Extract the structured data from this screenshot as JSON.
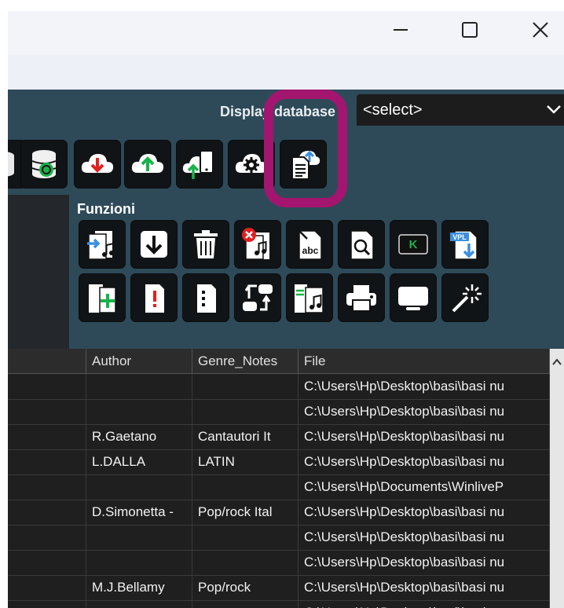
{
  "window": {
    "minimize_glyph": "—",
    "maximize_glyph": "☐",
    "close_glyph": "✕"
  },
  "toolbar": {
    "display_label": "Display database",
    "db_select_value": "<select>",
    "icons": [
      "database-partial-icon",
      "database-sync-icon",
      "cloud-download-icon",
      "cloud-upload-icon",
      "cloud-upload-mobile-icon",
      "cloud-settings-icon",
      "cloud-upload-document-icon"
    ]
  },
  "funzioni": {
    "label": "Funzioni",
    "row1": [
      "import-music-icon",
      "download-arrow-icon",
      "trash-icon",
      "delete-music-icon",
      "rename-abc-icon",
      "search-document-icon",
      "karaoke-k-icon",
      "vpl-download-icon"
    ],
    "row2": [
      "add-document-icon",
      "alert-document-icon",
      "list-document-icon",
      "swap-icon",
      "music-list-icon",
      "print-icon",
      "monitor-icon",
      "magic-wand-icon"
    ]
  },
  "table": {
    "columns": [
      "Author",
      "Genre_Notes",
      "File"
    ],
    "rows": [
      {
        "author": "",
        "genre": "",
        "file": "C:\\Users\\Hp\\Desktop\\basi\\basi nu"
      },
      {
        "author": "",
        "genre": "",
        "file": "C:\\Users\\Hp\\Desktop\\basi\\basi nu"
      },
      {
        "author": "R.Gaetano",
        "genre": "Cantautori It",
        "file": "C:\\Users\\Hp\\Desktop\\basi\\basi nu"
      },
      {
        "author": "L.DALLA",
        "genre": "LATIN",
        "file": "C:\\Users\\Hp\\Desktop\\basi\\basi nu"
      },
      {
        "author": "",
        "genre": "",
        "file": "C:\\Users\\Hp\\Documents\\WinliveP"
      },
      {
        "author": "D.Simonetta -",
        "genre": "Pop/rock Ital",
        "file": "C:\\Users\\Hp\\Desktop\\basi\\basi nu"
      },
      {
        "author": "",
        "genre": "",
        "file": "C:\\Users\\Hp\\Desktop\\basi\\basi nu"
      },
      {
        "author": "",
        "genre": "",
        "file": "C:\\Users\\Hp\\Desktop\\basi\\basi nu"
      },
      {
        "author": "M.J.Bellamy",
        "genre": "Pop/rock",
        "file": "C:\\Users\\Hp\\Desktop\\basi\\basi nu"
      },
      {
        "author": "",
        "genre": "",
        "file": "C:\\Users\\Hp\\Desktop\\basi\\basi nu"
      }
    ]
  },
  "colors": {
    "app_bg": "#2e4a59",
    "highlight": "#a3156e",
    "cloud_down": "#e02020",
    "cloud_up": "#18b34a"
  }
}
